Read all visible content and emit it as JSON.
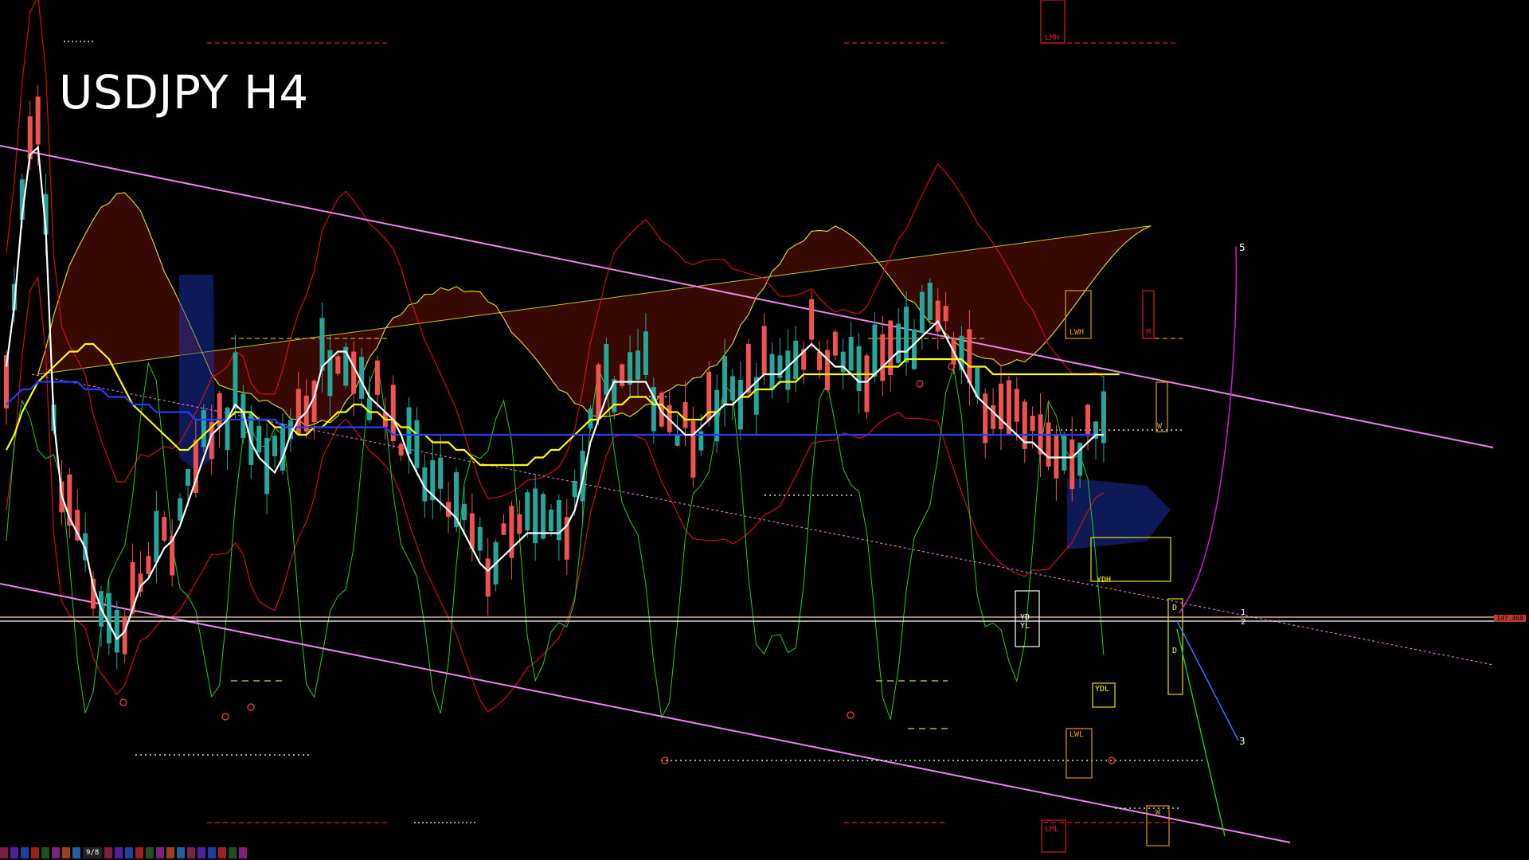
{
  "title": "USDJPY H4",
  "colors": {
    "background": "#000000",
    "bull": "#26a69a",
    "bear": "#ef5350",
    "channel": "#ee82ee",
    "ma_white": "#ffffff",
    "ma_yellow": "#ffff00",
    "ma_blue": "#1f3fff",
    "osc_green": "#1fcf1f",
    "band_red": "#d01010",
    "cloud_red": "#a01808",
    "cloud_blue": "#2038c0",
    "zone_orange": "#e0a000"
  },
  "labels": {
    "lmh": "LMH",
    "lwh": "LWH",
    "m": "M",
    "w_top": "W",
    "ydh": "YDH",
    "yd_box": "YD\nYL",
    "d_top": "D",
    "d_bot": "D",
    "ydl": "YDL",
    "lwl": "LWL",
    "w_bot": "W",
    "lml": "LML",
    "wave5": "5",
    "wave1": "1",
    "wave2": "2",
    "wave3": "3",
    "price_tag": "147.468",
    "strip_label": "9/8"
  },
  "chart_data": {
    "type": "line",
    "title": "USDJPY H4",
    "candle_count": 150,
    "series": [
      {
        "values": [
          0.62,
          0.7,
          0.82,
          0.9,
          0.91,
          0.8,
          0.55,
          0.45,
          0.42,
          0.4,
          0.38,
          0.33,
          0.3,
          0.28,
          0.26,
          0.27,
          0.3,
          0.33,
          0.34,
          0.36,
          0.38,
          0.39,
          0.41,
          0.44,
          0.47,
          0.5,
          0.53,
          0.54,
          0.55,
          0.57,
          0.56,
          0.52,
          0.5,
          0.49,
          0.48,
          0.5,
          0.53,
          0.55,
          0.56,
          0.58,
          0.62,
          0.63,
          0.64,
          0.64,
          0.62,
          0.6,
          0.58,
          0.57,
          0.56,
          0.55,
          0.53,
          0.5,
          0.48,
          0.46,
          0.45,
          0.44,
          0.43,
          0.42,
          0.4,
          0.38,
          0.36,
          0.35,
          0.36,
          0.37,
          0.38,
          0.39,
          0.4,
          0.4,
          0.4,
          0.4,
          0.4,
          0.41,
          0.43,
          0.47,
          0.52,
          0.55,
          0.58,
          0.6,
          0.6,
          0.6,
          0.6,
          0.6,
          0.58,
          0.56,
          0.55,
          0.54,
          0.53,
          0.53,
          0.54,
          0.55,
          0.56,
          0.57,
          0.57,
          0.58,
          0.59,
          0.6,
          0.61,
          0.61,
          0.61,
          0.62,
          0.63,
          0.64,
          0.65,
          0.64,
          0.63,
          0.62,
          0.62,
          0.61,
          0.6,
          0.6,
          0.61,
          0.62,
          0.63,
          0.64,
          0.64,
          0.65,
          0.66,
          0.67,
          0.68,
          0.66,
          0.64,
          0.62,
          0.6,
          0.58,
          0.57,
          0.56,
          0.55,
          0.54,
          0.53,
          0.52,
          0.52,
          0.51,
          0.5,
          0.5,
          0.5,
          0.5,
          0.51,
          0.52,
          0.53,
          0.53
        ]
      },
      {
        "values": [
          0.5,
          0.52,
          0.55,
          0.57,
          0.59,
          0.6,
          0.61,
          0.62,
          0.63,
          0.63,
          0.64,
          0.64,
          0.63,
          0.62,
          0.6,
          0.58,
          0.56,
          0.55,
          0.54,
          0.53,
          0.52,
          0.51,
          0.5,
          0.5,
          0.51,
          0.52,
          0.53,
          0.54,
          0.54,
          0.55,
          0.55,
          0.55,
          0.54,
          0.54,
          0.53,
          0.53,
          0.53,
          0.52,
          0.52,
          0.53,
          0.53,
          0.54,
          0.55,
          0.55,
          0.56,
          0.56,
          0.55,
          0.55,
          0.54,
          0.54,
          0.53,
          0.53,
          0.52,
          0.52,
          0.51,
          0.51,
          0.51,
          0.5,
          0.5,
          0.49,
          0.48,
          0.48,
          0.48,
          0.48,
          0.48,
          0.48,
          0.48,
          0.49,
          0.49,
          0.5,
          0.5,
          0.51,
          0.52,
          0.53,
          0.54,
          0.54,
          0.55,
          0.56,
          0.56,
          0.57,
          0.57,
          0.57,
          0.56,
          0.56,
          0.55,
          0.55,
          0.54,
          0.54,
          0.54,
          0.55,
          0.55,
          0.56,
          0.56,
          0.57,
          0.57,
          0.58,
          0.58,
          0.58,
          0.59,
          0.59,
          0.59,
          0.6,
          0.6,
          0.6,
          0.6,
          0.6,
          0.6,
          0.6,
          0.6,
          0.6,
          0.6,
          0.61,
          0.61,
          0.61,
          0.62,
          0.62,
          0.62,
          0.62,
          0.62,
          0.62,
          0.62,
          0.62,
          0.61,
          0.61,
          0.61,
          0.6,
          0.6,
          0.6,
          0.6,
          0.6,
          0.6,
          0.6,
          0.6,
          0.6,
          0.6,
          0.6,
          0.6,
          0.6,
          0.6,
          0.6,
          0.6,
          0.6
        ]
      },
      {
        "values": [
          0.56,
          0.57,
          0.58,
          0.58,
          0.59,
          0.59,
          0.59,
          0.59,
          0.59,
          0.59,
          0.58,
          0.58,
          0.58,
          0.57,
          0.57,
          0.57,
          0.56,
          0.56,
          0.56,
          0.55,
          0.55,
          0.55,
          0.55,
          0.55,
          0.54,
          0.54,
          0.54,
          0.54,
          0.54,
          0.54,
          0.54,
          0.54,
          0.54,
          0.54,
          0.54,
          0.53,
          0.53,
          0.53,
          0.53,
          0.53,
          0.53,
          0.53,
          0.53,
          0.53,
          0.53,
          0.53,
          0.53,
          0.53,
          0.53,
          0.52,
          0.52,
          0.52,
          0.52,
          0.52,
          0.52,
          0.52,
          0.52,
          0.52,
          0.52,
          0.52,
          0.52,
          0.52,
          0.52,
          0.52,
          0.52,
          0.52,
          0.52,
          0.52,
          0.52,
          0.52,
          0.52,
          0.52,
          0.52,
          0.52,
          0.52,
          0.52,
          0.52,
          0.52,
          0.52,
          0.52,
          0.52,
          0.52,
          0.52,
          0.52,
          0.52,
          0.52,
          0.52,
          0.52,
          0.52,
          0.52,
          0.52,
          0.52,
          0.52,
          0.52,
          0.52,
          0.52,
          0.52,
          0.52,
          0.52,
          0.52,
          0.52,
          0.52,
          0.52,
          0.52,
          0.52,
          0.52,
          0.52,
          0.52,
          0.52,
          0.52,
          0.52,
          0.52,
          0.52,
          0.52,
          0.52,
          0.52,
          0.52,
          0.52,
          0.52,
          0.52,
          0.52,
          0.52,
          0.52,
          0.52,
          0.52,
          0.52,
          0.52,
          0.52,
          0.52,
          0.52,
          0.52,
          0.52,
          0.52,
          0.52,
          0.52,
          0.52,
          0.52,
          0.52,
          0.52,
          0.52
        ]
      }
    ],
    "ylim": [
      0,
      1
    ],
    "grid": false
  }
}
